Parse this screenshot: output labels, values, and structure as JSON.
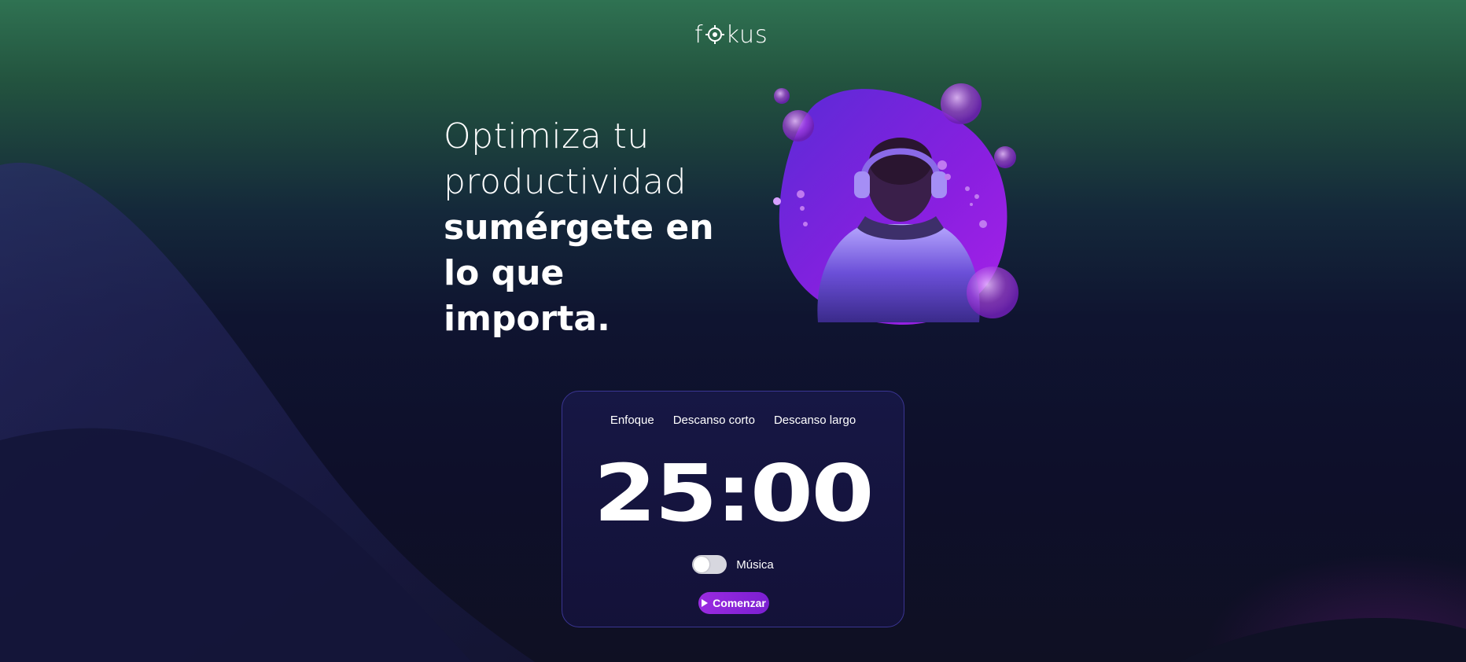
{
  "app": {
    "logo_left": "f",
    "logo_right": "kus"
  },
  "hero": {
    "line1": "Optimiza tu",
    "line2": "productividad",
    "line3": "sumérgete en",
    "line4": "lo que",
    "line5": "importa.",
    "image_icon": "astronaut-with-headphones-bubbles"
  },
  "timer": {
    "tabs": [
      {
        "label": "Enfoque"
      },
      {
        "label": "Descanso corto"
      },
      {
        "label": "Descanso largo"
      }
    ],
    "time": "25:00",
    "music_label": "Música",
    "music_enabled": false,
    "start_label": "Comenzar",
    "start_icon": "play-icon"
  },
  "colors": {
    "accent": "#8a25d8",
    "card_border": "#3a3592",
    "bg_top": "#2f7252",
    "bg_bottom": "#0f1023"
  }
}
